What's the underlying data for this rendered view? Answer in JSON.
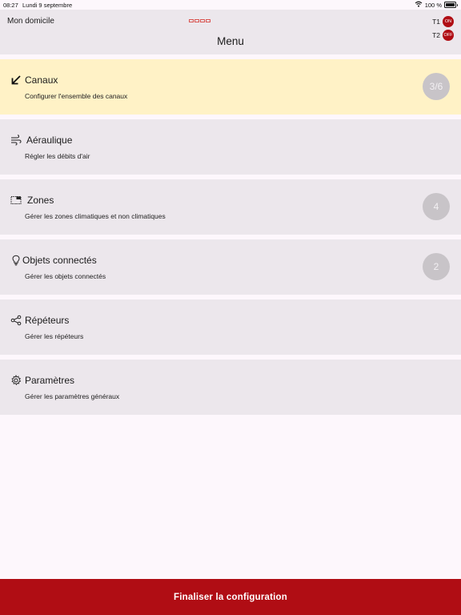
{
  "status_bar": {
    "time": "08:27",
    "date": "Lundi 9 septembre",
    "battery": "100 %"
  },
  "header": {
    "home_label": "Mon domicile",
    "title": "Menu",
    "thermostats": [
      {
        "label": "T1",
        "state": "ON"
      },
      {
        "label": "T2",
        "state": "OFF"
      }
    ]
  },
  "menu": [
    {
      "title": "Canaux",
      "description": "Configurer l'ensemble des canaux",
      "badge": "3/6",
      "icon": "arrow-down-left-icon",
      "selected": true
    },
    {
      "title": "Aéraulique",
      "description": "Régler les débits d'air",
      "badge": "",
      "icon": "airflow-icon",
      "selected": false
    },
    {
      "title": "Zones",
      "description": "Gérer les zones climatiques et non climatiques",
      "badge": "4",
      "icon": "zones-icon",
      "selected": false
    },
    {
      "title": "Objets connectés",
      "description": "Gérer les objets connectés",
      "badge": "2",
      "icon": "lightbulb-icon",
      "selected": false
    },
    {
      "title": "Répéteurs",
      "description": "Gérer les répéteurs",
      "badge": "",
      "icon": "share-icon",
      "selected": false
    },
    {
      "title": "Paramètres",
      "description": "Gérer les paramètres généraux",
      "badge": "",
      "icon": "gear-icon",
      "selected": false
    }
  ],
  "footer": {
    "button_label": "Finaliser la configuration"
  },
  "colors": {
    "accent": "#b00d14",
    "selected_bg": "#fff2c6",
    "card_bg": "#ece7ec",
    "badge_bg": "#c8c4c8"
  }
}
